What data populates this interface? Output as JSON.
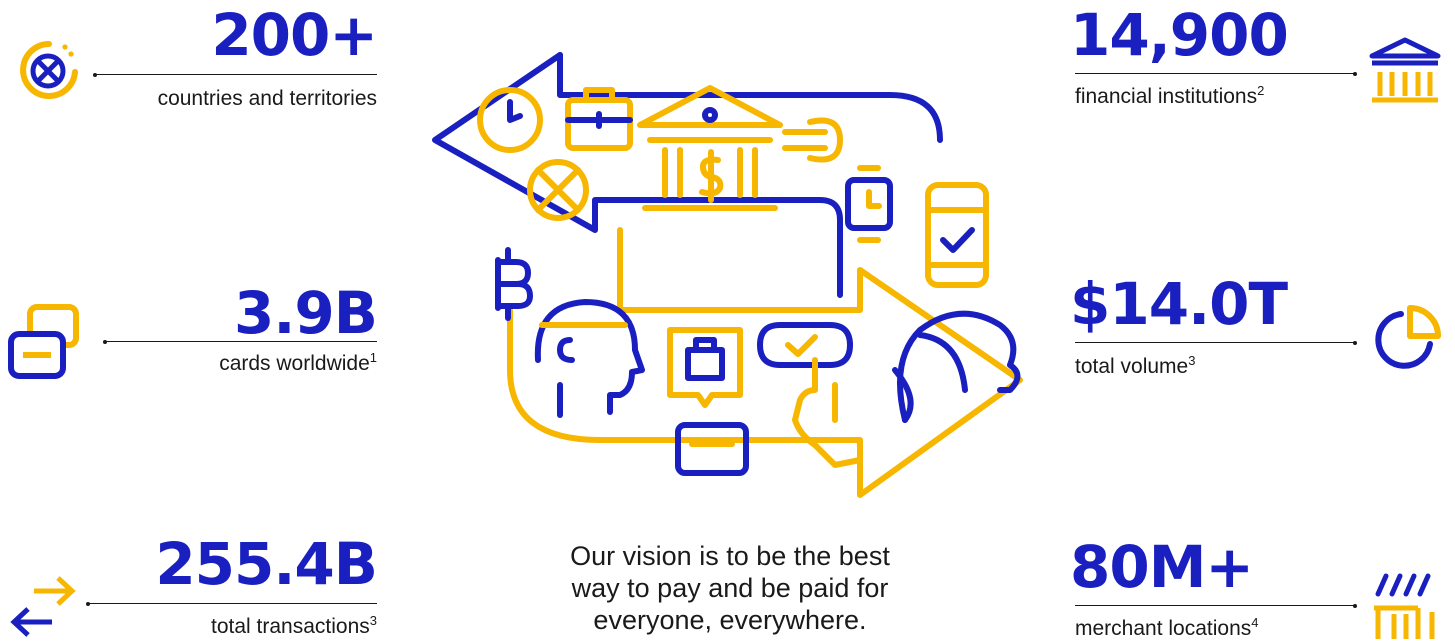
{
  "stats": {
    "countries": {
      "value": "200+",
      "label": "countries and territories",
      "icon": "globe-icon"
    },
    "cards": {
      "value": "3.9B",
      "label": "cards worldwide",
      "footnote": "1",
      "icon": "cards-icon"
    },
    "transactions": {
      "value": "255.4B",
      "label": "total transactions",
      "footnote": "3",
      "icon": "transfer-arrows-icon"
    },
    "institutions": {
      "value": "14,900",
      "label": "financial institutions",
      "footnote": "2",
      "icon": "bank-icon"
    },
    "volume": {
      "value": "$14.0T",
      "label": "total volume",
      "footnote": "3",
      "icon": "pie-chart-icon"
    },
    "merchants": {
      "value": "80M+",
      "label": "merchant locations",
      "footnote": "4",
      "icon": "storefront-icon"
    }
  },
  "vision": {
    "line1": "Our vision is to be the best",
    "line2": "way to pay and be paid for",
    "line3": "everyone, everywhere."
  },
  "colors": {
    "blue": "#1a1fbf",
    "yellow": "#f7b600",
    "text": "#1a1a1a"
  }
}
